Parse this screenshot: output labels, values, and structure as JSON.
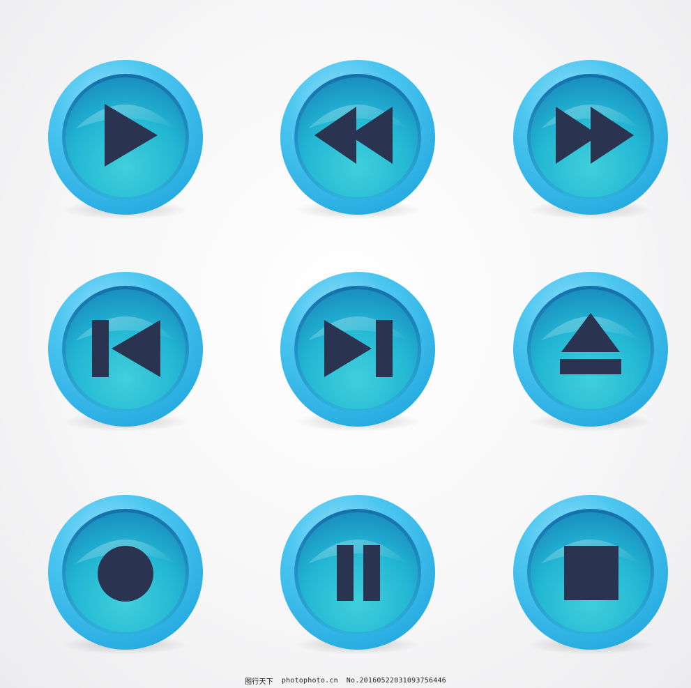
{
  "colors": {
    "background": "#f4f4f6",
    "ring": "#3fc2ee",
    "inner": "#2ab8d6",
    "glyph": "#2a3350"
  },
  "buttons": [
    {
      "name": "play-button",
      "icon": "play-icon"
    },
    {
      "name": "rewind-button",
      "icon": "rewind-icon"
    },
    {
      "name": "fast-forward-button",
      "icon": "fast-forward-icon"
    },
    {
      "name": "skip-previous-button",
      "icon": "skip-previous-icon"
    },
    {
      "name": "skip-next-button",
      "icon": "skip-next-icon"
    },
    {
      "name": "eject-button",
      "icon": "eject-icon"
    },
    {
      "name": "record-button",
      "icon": "record-icon"
    },
    {
      "name": "pause-button",
      "icon": "pause-icon"
    },
    {
      "name": "stop-button",
      "icon": "stop-icon"
    }
  ],
  "watermark": {
    "site_cn": "图行天下",
    "site_url": "photophoto.cn",
    "number": "No.20160522031093756446"
  }
}
